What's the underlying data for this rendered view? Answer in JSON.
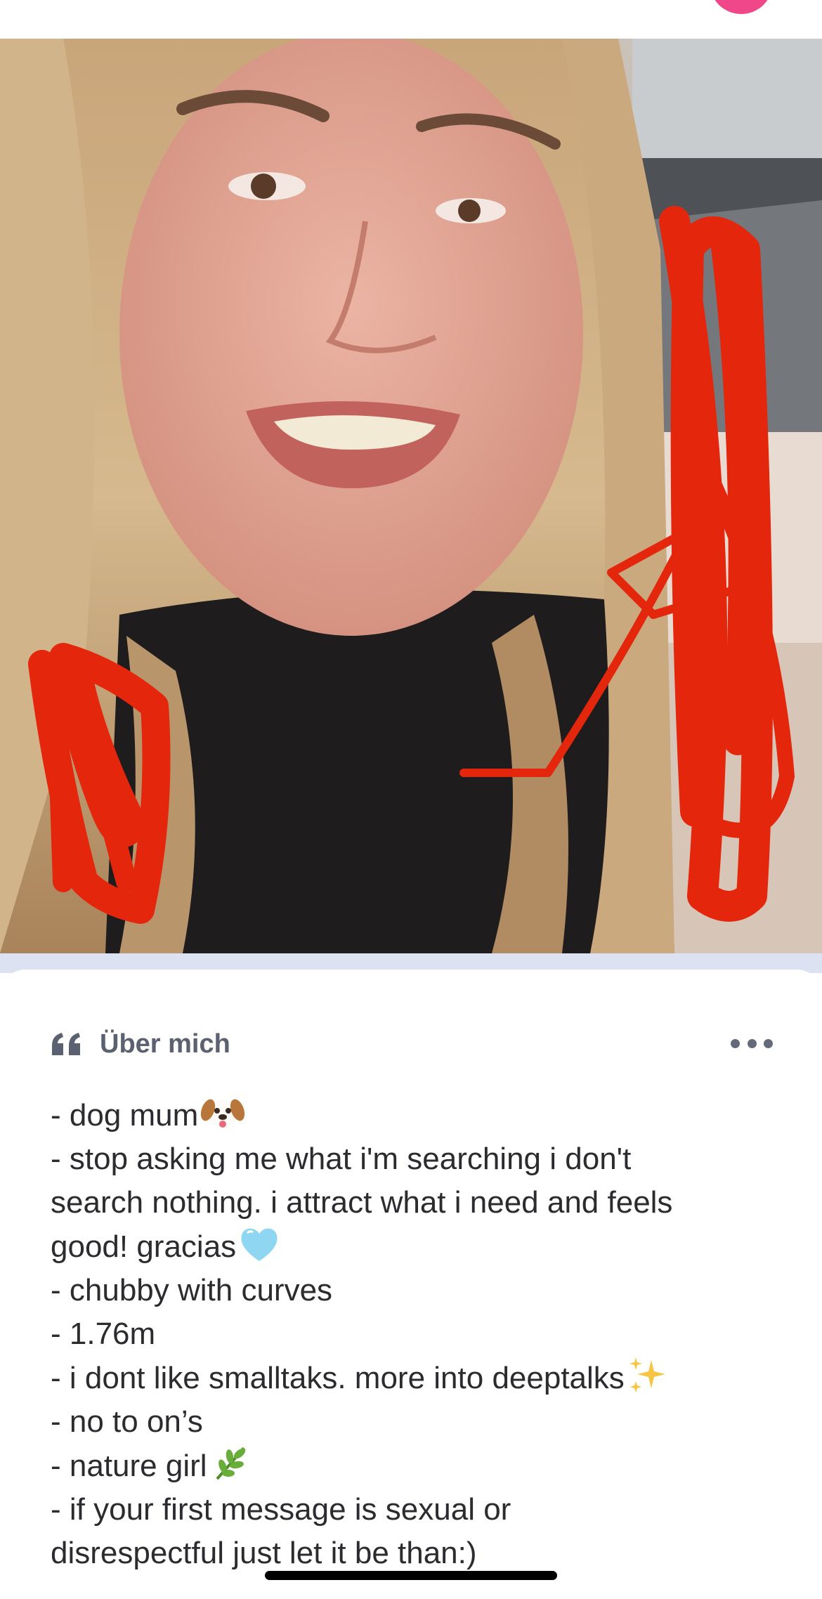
{
  "profile": {
    "section_title": "Über mich",
    "bio_lines": [
      "- dog mum",
      "- stop asking me what i'm searching i don't",
      "search nothing. i attract what i need and feels",
      "good! gracias",
      "- chubby with curves",
      "- 1.76m",
      "- i dont like smalltaks. more into deeptalks",
      "- no to on’s",
      "- nature girl",
      "- if your first message is sexual or",
      "disrespectful just let it be than:)"
    ]
  },
  "icons": {
    "quote": "quote-icon",
    "more": "more-options-icon",
    "dog": "dog-face-emoji",
    "heart": "light-blue-heart-emoji",
    "sparkles": "sparkles-emoji",
    "herb": "herb-emoji"
  },
  "colors": {
    "accent_pink": "#f0468a",
    "separator": "#dde2f3",
    "heading": "#5b6171",
    "text": "#2c2c30",
    "scribble": "#e4260c"
  }
}
